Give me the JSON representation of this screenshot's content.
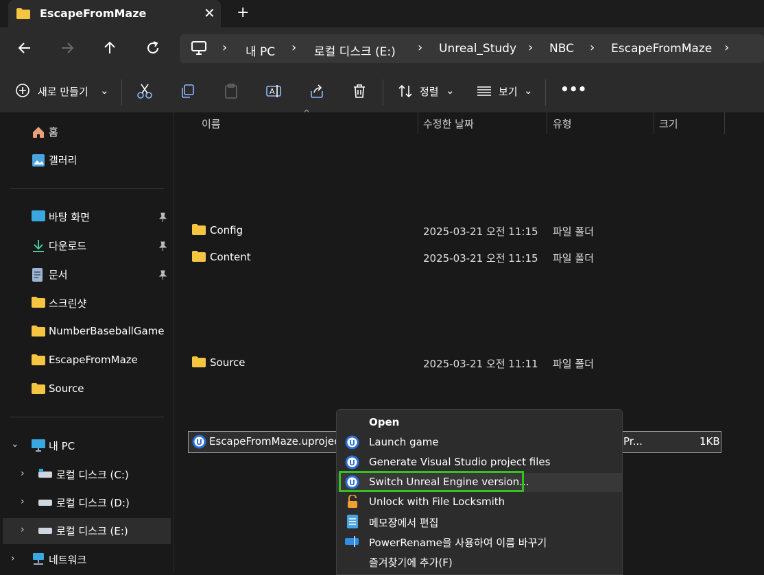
{
  "tab": {
    "title": "EscapeFromMaze"
  },
  "breadcrumb": [
    "내 PC",
    "로컬 디스크 (E:)",
    "Unreal_Study",
    "NBC",
    "EscapeFromMaze"
  ],
  "toolbar": {
    "new_label": "새로 만들기",
    "sort_label": "정렬",
    "view_label": "보기"
  },
  "sidebar": {
    "home": "홈",
    "gallery": "갤러리",
    "quick": [
      "바탕 화면",
      "다운로드",
      "문서",
      "스크린샷",
      "NumberBaseballGame",
      "EscapeFromMaze",
      "Source"
    ],
    "this_pc": "내 PC",
    "drives": [
      "로컬 디스크 (C:)",
      "로컬 디스크 (D:)",
      "로컬 디스크 (E:)"
    ],
    "network": "네트워크"
  },
  "columns": {
    "name": "이름",
    "date": "수정한 날짜",
    "type": "유형",
    "size": "크기"
  },
  "files": [
    {
      "name": "Config",
      "date": "2025-03-21 오전 11:15",
      "type": "파일 폴더"
    },
    {
      "name": "Content",
      "date": "2025-03-21 오전 11:15",
      "type": "파일 폴더"
    },
    {
      "name": "Source",
      "date": "2025-03-21 오전 11:11",
      "type": "파일 폴더"
    }
  ],
  "selected_file": {
    "name": "EscapeFromMaze.uproject",
    "type_partial": "Pr...",
    "size": "1KB"
  },
  "context_menu": {
    "items": [
      "Open",
      "Launch game",
      "Generate Visual Studio project files",
      "Switch Unreal Engine version...",
      "Unlock with File Locksmith",
      "메모장에서 편집",
      "PowerRename을 사용하여 이름 바꾸기",
      "즐겨찾기에 추가(F)"
    ],
    "highlighted_index": 3
  },
  "colors": {
    "folder": "#f5c542",
    "highlight": "#35c21f",
    "background": "#191919"
  }
}
